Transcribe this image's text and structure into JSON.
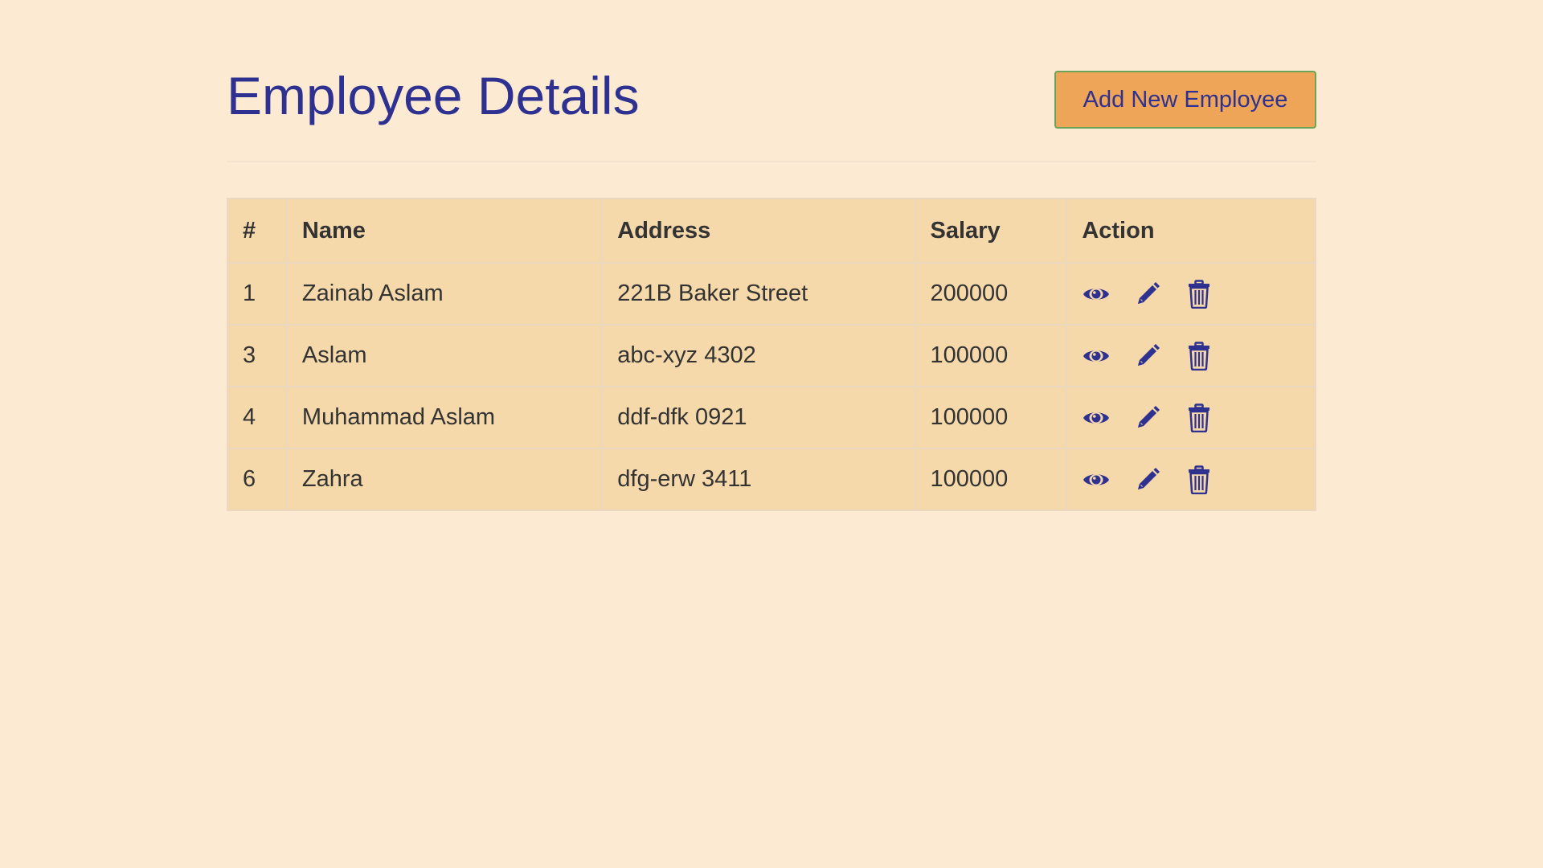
{
  "header": {
    "title": "Employee Details",
    "add_button_label": "Add New Employee"
  },
  "table": {
    "columns": [
      "#",
      "Name",
      "Address",
      "Salary",
      "Action"
    ],
    "rows": [
      {
        "id": "1",
        "name": "Zainab Aslam",
        "address": "221B Baker Street",
        "salary": "200000"
      },
      {
        "id": "3",
        "name": "Aslam",
        "address": "abc-xyz 4302",
        "salary": "100000"
      },
      {
        "id": "4",
        "name": "Muhammad Aslam",
        "address": "ddf-dfk 0921",
        "salary": "100000"
      },
      {
        "id": "6",
        "name": "Zahra",
        "address": "dfg-erw 3411",
        "salary": "100000"
      }
    ],
    "action_icons": [
      "eye-icon",
      "pencil-icon",
      "trash-icon"
    ]
  },
  "colors": {
    "background": "#fcebd2",
    "accent_text": "#2e3190",
    "button_bg": "#efa557",
    "button_border": "#6aa35a",
    "table_bg": "#f6d9aa"
  }
}
